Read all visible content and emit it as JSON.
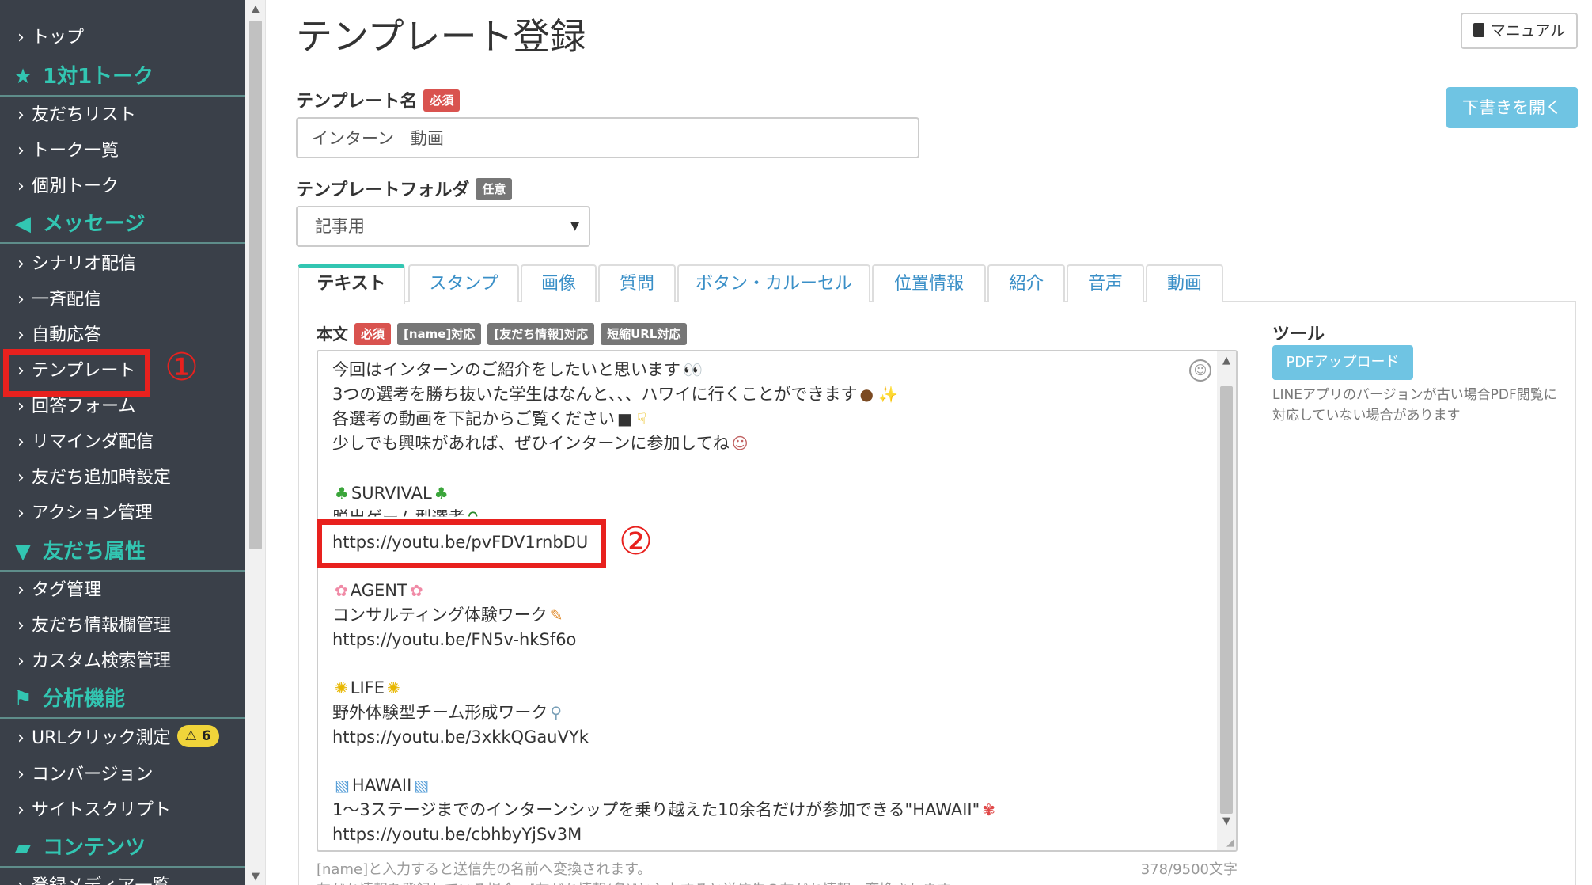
{
  "sidebar": {
    "top": "トップ",
    "sections": {
      "talk": "1対1トーク",
      "message": "メッセージ",
      "friend_attr": "友だち属性",
      "analysis": "分析機能",
      "contents": "コンテンツ"
    },
    "items": {
      "friend_list": "友だちリスト",
      "talk_list": "トーク一覧",
      "individual_talk": "個別トーク",
      "scenario": "シナリオ配信",
      "broadcast": "一斉配信",
      "auto_reply": "自動応答",
      "template": "テンプレート",
      "answer_form": "回答フォーム",
      "reminder": "リマインダ配信",
      "friend_add": "友だち追加時設定",
      "action": "アクション管理",
      "tag": "タグ管理",
      "friend_info": "友だち情報欄管理",
      "custom_search": "カスタム検索管理",
      "url_click": "URLクリック測定",
      "conversion": "コンバージョン",
      "site_script": "サイトスクリプト",
      "media": "登録メディア一覧"
    },
    "url_click_warning_count": "6",
    "icons": {
      "talk": "star-icon",
      "message": "megaphone-icon",
      "friend_attr": "filter-icon",
      "analysis": "flag-icon",
      "contents": "folder-icon"
    }
  },
  "header": {
    "title": "テンプレート登録",
    "manual": "マニュアル",
    "open_draft": "下書きを開く"
  },
  "form": {
    "template_name_label": "テンプレート名",
    "required": "必須",
    "template_name_value": "インターン　動画",
    "folder_label": "テンプレートフォルダ",
    "optional": "任意",
    "folder_value": "記事用"
  },
  "tabs": [
    "テキスト",
    "スタンプ",
    "画像",
    "質問",
    "ボタン・カルーセル",
    "位置情報",
    "紹介",
    "音声",
    "動画"
  ],
  "body": {
    "label": "本文",
    "required": "必須",
    "badges": [
      "[name]対応",
      "[友だち情報]対応",
      "短縮URL対応"
    ],
    "lines": {
      "l1": "今回はインターンのご紹介をしたいと思います",
      "l2": "3つの選考を勝ち抜いた学生はなんと、、、ハワイに行くことができます",
      "l3": "各選考の動画を下記からご覧ください",
      "l4": "少しでも興味があれば、ぜひインターンに参加してね",
      "s1_title": "SURVIVAL",
      "s1_desc": "脱出ゲーム型選考",
      "s1_url": "https://youtu.be/pvFDV1rnbDU",
      "s2_title": "AGENT",
      "s2_desc": "コンサルティング体験ワーク",
      "s2_url": "https://youtu.be/FN5v-hkSf6o",
      "s3_title": "LIFE",
      "s3_desc": "野外体験型チーム形成ワーク",
      "s3_url": "https://youtu.be/3xkkQGauVYk",
      "s4_title": "HAWAII",
      "s4_desc": "1〜3ステージまでのインターンシップを乗り越えた10余名だけが参加できる\"HAWAII\"",
      "s4_url": "https://youtu.be/cbhbyYjSv3M"
    },
    "hint": "[name]と入力すると送信先の名前へ変換されます。",
    "hint2": "友だち情報を登録している場合、[友だち情報(名)]と入力すると送信先の友だち情報へ変換されます。",
    "char_count": "378/9500文字"
  },
  "tools": {
    "label": "ツール",
    "pdf_upload": "PDFアップロード",
    "note": "LINEアプリのバージョンが古い場合PDF閲覧に対応していない場合があります"
  },
  "annotations": {
    "one": "①",
    "two": "②"
  },
  "colors": {
    "sidebar_bg": "#3a4049",
    "accent": "#32c6b2",
    "link": "#3a8fc7",
    "button": "#6fc4e3",
    "required": "#d9534f",
    "annotation": "#e8211e"
  }
}
